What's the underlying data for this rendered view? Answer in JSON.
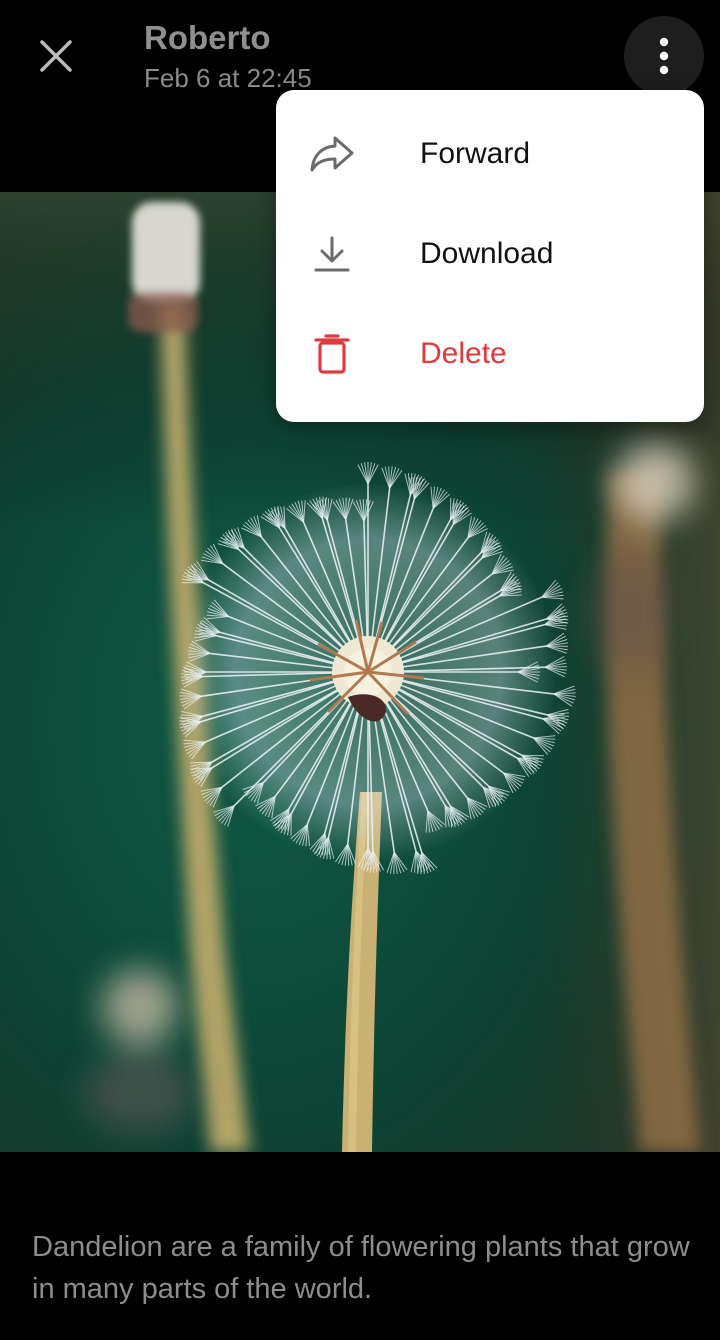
{
  "header": {
    "sender_name": "Roberto",
    "timestamp": "Feb 6 at 22:45",
    "close_icon": "close-icon",
    "more_icon": "more-vertical-icon"
  },
  "menu": {
    "items": [
      {
        "label": "Forward",
        "icon": "forward-icon"
      },
      {
        "label": "Download",
        "icon": "download-icon"
      },
      {
        "label": "Delete",
        "icon": "trash-icon",
        "color": "#e0393e"
      }
    ]
  },
  "photo": {
    "subject": "dandelion-photo"
  },
  "caption": {
    "text": "Dandelion are a family of flowering plants that grow in many parts of the world."
  },
  "colors": {
    "background": "#000000",
    "menu_background": "#ffffff",
    "danger": "#e0393e",
    "icon_gray": "#6b6b6b"
  }
}
